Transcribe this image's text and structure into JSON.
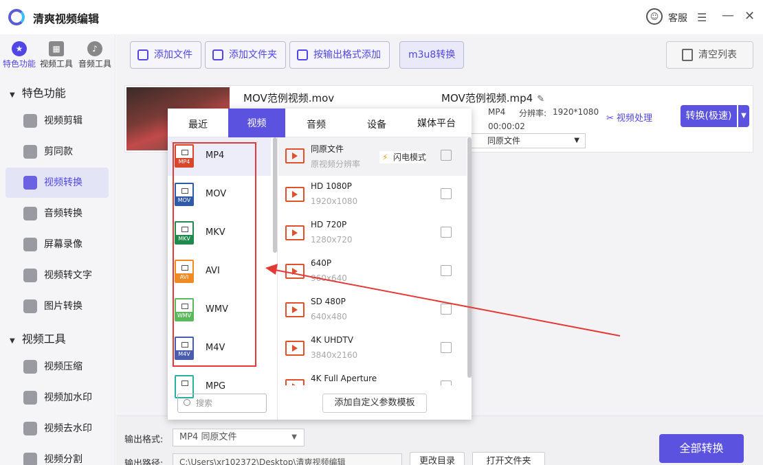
{
  "app": {
    "title": "清爽视频编辑"
  },
  "window": {
    "service_label": "客服",
    "menu_glyph": "☰",
    "minimize_glyph": "—",
    "close_glyph": "✕"
  },
  "sidebar": {
    "top_categories": [
      {
        "label": "特色功能",
        "icon": "star-icon"
      },
      {
        "label": "视频工具",
        "icon": "film-icon"
      },
      {
        "label": "音频工具",
        "icon": "music-icon"
      }
    ],
    "section_feature": "特色功能",
    "feature_items": [
      {
        "label": "视频剪辑"
      },
      {
        "label": "剪同款"
      },
      {
        "label": "视频转换"
      },
      {
        "label": "音频转换"
      },
      {
        "label": "屏幕录像"
      },
      {
        "label": "视频转文字"
      },
      {
        "label": "图片转换"
      }
    ],
    "section_video": "视频工具",
    "video_items": [
      {
        "label": "视频压缩"
      },
      {
        "label": "视频加水印"
      },
      {
        "label": "视频去水印"
      },
      {
        "label": "视频分割"
      }
    ]
  },
  "toolbar": {
    "add_file": "添加文件",
    "add_folder": "添加文件夹",
    "add_by_format": "按输出格式添加",
    "m3u8": "m3u8转换",
    "clear_list": "清空列表"
  },
  "file": {
    "src_name": "MOV范例视频.mov",
    "dst_name": "MOV范例视频.mp4",
    "dst_format": "MP4",
    "resolution_label": "分辨率:",
    "resolution": "1920*1080",
    "duration": "00:00:02",
    "preset": "同原文件",
    "process_label": "视频处理",
    "convert_label": "转换(极速)"
  },
  "popup": {
    "tabs": [
      "最近",
      "视频",
      "音频",
      "设备",
      "媒体平台"
    ],
    "active_tab": "视频",
    "formats": [
      {
        "name": "MP4",
        "color": "#d9472b"
      },
      {
        "name": "MOV",
        "color": "#2f5aa8"
      },
      {
        "name": "MKV",
        "color": "#1f8a4c"
      },
      {
        "name": "AVI",
        "color": "#f08a24"
      },
      {
        "name": "WMV",
        "color": "#5cb85c"
      },
      {
        "name": "M4V",
        "color": "#4a5cb0"
      },
      {
        "name": "MPG",
        "color": "#2ab0a0"
      }
    ],
    "search_placeholder": "搜索",
    "presets": [
      {
        "name": "同原文件",
        "sub": "原视频分辨率"
      },
      {
        "name": "HD 1080P",
        "sub": "1920x1080"
      },
      {
        "name": "HD 720P",
        "sub": "1280x720"
      },
      {
        "name": "640P",
        "sub": "960x640"
      },
      {
        "name": "SD 480P",
        "sub": "640x480"
      },
      {
        "name": "4K UHDTV",
        "sub": "3840x2160"
      },
      {
        "name": "4K Full Aperture",
        "sub": ""
      }
    ],
    "flash_mode": "闪电模式",
    "add_template": "添加自定义参数模板"
  },
  "bottom": {
    "format_label": "输出格式:",
    "format_value": "MP4  同原文件",
    "path_label": "输出路径:",
    "path_value": "C:\\Users\\xr102372\\Desktop\\清爽视频编辑",
    "change_dir": "更改目录",
    "open_folder": "打开文件夹",
    "convert_all": "全部转换"
  }
}
